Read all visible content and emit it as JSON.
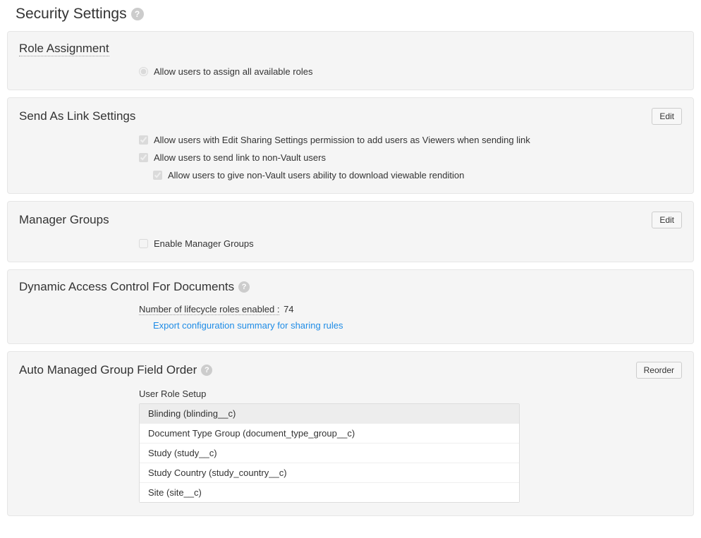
{
  "page": {
    "title": "Security Settings"
  },
  "roleAssignment": {
    "title": "Role Assignment",
    "option": "Allow users to assign all available roles"
  },
  "sendAsLink": {
    "title": "Send As Link Settings",
    "editLabel": "Edit",
    "opt1": "Allow users with Edit Sharing Settings permission to add users as Viewers when sending link",
    "opt2": "Allow users to send link to non-Vault users",
    "opt3": "Allow users to give non-Vault users ability to download viewable rendition"
  },
  "managerGroups": {
    "title": "Manager Groups",
    "editLabel": "Edit",
    "opt": "Enable Manager Groups"
  },
  "dac": {
    "title": "Dynamic Access Control For Documents",
    "countLabel": "Number of lifecycle roles enabled :",
    "countValue": "74",
    "exportLink": "Export configuration summary for sharing rules"
  },
  "autoGroup": {
    "title": "Auto Managed Group Field Order",
    "reorderLabel": "Reorder",
    "tableLabel": "User Role Setup",
    "rows": [
      "Blinding (blinding__c)",
      "Document Type Group (document_type_group__c)",
      "Study (study__c)",
      "Study Country (study_country__c)",
      "Site (site__c)"
    ]
  }
}
